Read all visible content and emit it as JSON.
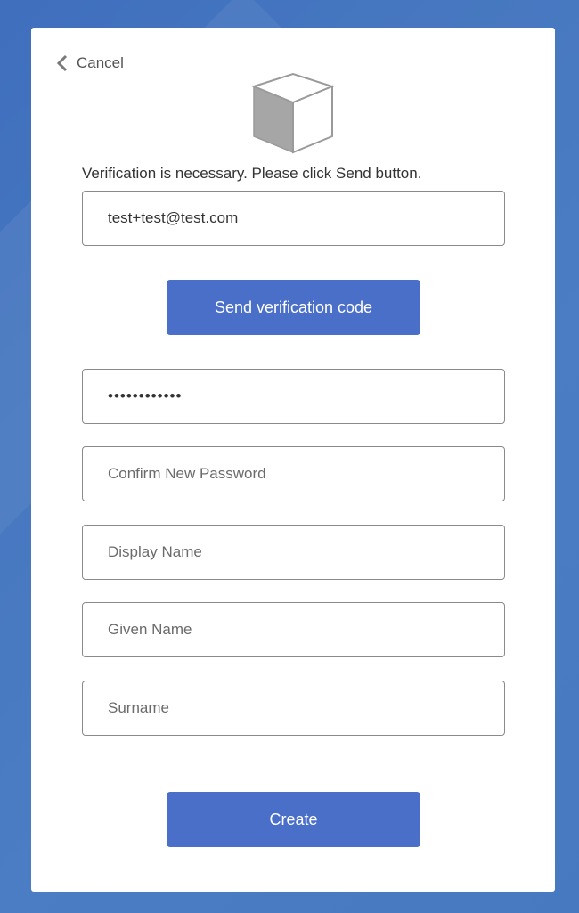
{
  "header": {
    "cancel_label": "Cancel"
  },
  "icons": {
    "back": "chevron-left-icon",
    "logo": "cube-icon"
  },
  "form": {
    "instructions": "Verification is necessary. Please click Send button.",
    "email": {
      "value": "test+test@test.com"
    },
    "send_code_label": "Send verification code",
    "new_password": {
      "value": "••••••••••••"
    },
    "confirm_password": {
      "placeholder": "Confirm New Password"
    },
    "display_name": {
      "placeholder": "Display Name"
    },
    "given_name": {
      "placeholder": "Given Name"
    },
    "surname": {
      "placeholder": "Surname"
    },
    "create_label": "Create"
  },
  "colors": {
    "page_background": "#4a7cc2",
    "button": "#4a6fc9",
    "field_border": "#8a8a8a",
    "card": "#ffffff"
  }
}
